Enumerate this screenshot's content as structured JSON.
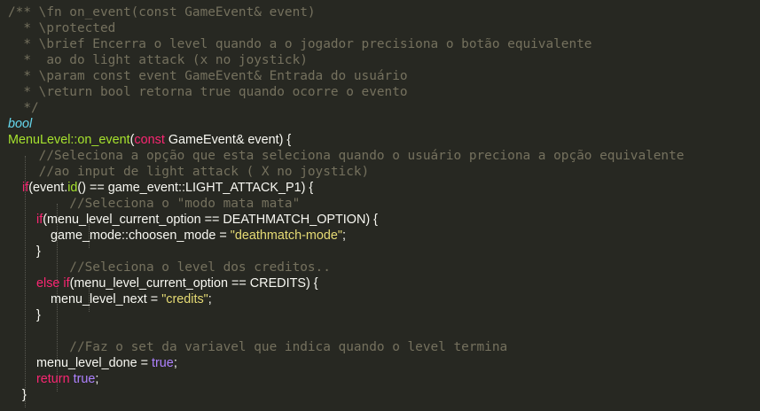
{
  "editor": {
    "theme_colors": {
      "background": "#272822",
      "comment": "#75715E",
      "plain": "#F8F8F2",
      "type": "#66D9EF",
      "function": "#A6E22E",
      "keyword": "#F92672",
      "string": "#E6DB74",
      "constant": "#AE81FF"
    },
    "lines": [
      {
        "tokens": [
          {
            "t": "/** \\fn on_event(const GameEvent& event)",
            "k": "comment",
            "f": "mono"
          }
        ]
      },
      {
        "tokens": [
          {
            "t": "  * \\protected",
            "k": "comment",
            "f": "mono"
          }
        ]
      },
      {
        "tokens": [
          {
            "t": "  * \\brief Encerra o level quando a o jogador precisiona o botão equivalente",
            "k": "comment",
            "f": "mono"
          }
        ]
      },
      {
        "tokens": [
          {
            "t": "  *  ao do light attack (x no joystick)",
            "k": "comment",
            "f": "mono"
          }
        ]
      },
      {
        "tokens": [
          {
            "t": "  * \\param const event GameEvent& Entrada do usuário",
            "k": "comment",
            "f": "mono"
          }
        ]
      },
      {
        "tokens": [
          {
            "t": "  * \\return bool retorna true quando ocorre o evento",
            "k": "comment",
            "f": "mono"
          }
        ]
      },
      {
        "tokens": [
          {
            "t": "  */",
            "k": "comment",
            "f": "mono"
          }
        ]
      },
      {
        "tokens": [
          {
            "t": "bool",
            "k": "type",
            "f": "sans"
          }
        ]
      },
      {
        "tokens": [
          {
            "t": "MenuLevel::on_event",
            "k": "function",
            "f": "sans"
          },
          {
            "t": "(",
            "k": "plain",
            "f": "sans"
          },
          {
            "t": "const",
            "k": "keyword",
            "f": "sans"
          },
          {
            "t": " GameEvent& event) {",
            "k": "plain",
            "f": "sans"
          }
        ]
      },
      {
        "tokens": [
          {
            "t": "    //Seleciona a opção que esta seleciona quando o usuário preciona a opção equivalente",
            "k": "comment",
            "f": "mono"
          }
        ]
      },
      {
        "tokens": [
          {
            "t": "    //ao input de light attack ( X no joystick)",
            "k": "comment",
            "f": "mono"
          }
        ]
      },
      {
        "tokens": [
          {
            "t": "    ",
            "k": "plain",
            "f": "sans"
          },
          {
            "t": "if",
            "k": "keyword",
            "f": "sans"
          },
          {
            "t": "(event.",
            "k": "plain",
            "f": "sans"
          },
          {
            "t": "id",
            "k": "function",
            "f": "sans"
          },
          {
            "t": "() == game_event::LIGHT_ATTACK_P1) {",
            "k": "plain",
            "f": "sans"
          }
        ]
      },
      {
        "tokens": [
          {
            "t": "        //Seleciona o \"modo mata mata\"",
            "k": "comment",
            "f": "mono"
          }
        ]
      },
      {
        "tokens": [
          {
            "t": "        ",
            "k": "plain",
            "f": "sans"
          },
          {
            "t": "if",
            "k": "keyword",
            "f": "sans"
          },
          {
            "t": "(menu_level_current_option == DEATHMATCH_OPTION) {",
            "k": "plain",
            "f": "sans"
          }
        ]
      },
      {
        "tokens": [
          {
            "t": "            game_mode::choosen_mode = ",
            "k": "plain",
            "f": "sans"
          },
          {
            "t": "\"deathmatch-mode\"",
            "k": "string",
            "f": "sans"
          },
          {
            "t": ";",
            "k": "plain",
            "f": "sans"
          }
        ]
      },
      {
        "tokens": [
          {
            "t": "        }",
            "k": "plain",
            "f": "sans"
          }
        ]
      },
      {
        "tokens": [
          {
            "t": "        //Seleciona o level dos creditos..",
            "k": "comment",
            "f": "mono"
          }
        ]
      },
      {
        "tokens": [
          {
            "t": "        ",
            "k": "plain",
            "f": "sans"
          },
          {
            "t": "else if",
            "k": "keyword",
            "f": "sans"
          },
          {
            "t": "(menu_level_current_option == CREDITS) {",
            "k": "plain",
            "f": "sans"
          }
        ]
      },
      {
        "tokens": [
          {
            "t": "            menu_level_next = ",
            "k": "plain",
            "f": "sans"
          },
          {
            "t": "\"credits\"",
            "k": "string",
            "f": "sans"
          },
          {
            "t": ";",
            "k": "plain",
            "f": "sans"
          }
        ]
      },
      {
        "tokens": [
          {
            "t": "        }",
            "k": "plain",
            "f": "sans"
          }
        ]
      },
      {
        "tokens": [
          {
            "t": "",
            "k": "plain",
            "f": "sans"
          }
        ]
      },
      {
        "tokens": [
          {
            "t": "        //Faz o set da variavel que indica quando o level termina",
            "k": "comment",
            "f": "mono"
          }
        ]
      },
      {
        "tokens": [
          {
            "t": "        menu_level_done = ",
            "k": "plain",
            "f": "sans"
          },
          {
            "t": "true",
            "k": "constant",
            "f": "sans"
          },
          {
            "t": ";",
            "k": "plain",
            "f": "sans"
          }
        ]
      },
      {
        "tokens": [
          {
            "t": "        ",
            "k": "plain",
            "f": "sans"
          },
          {
            "t": "return",
            "k": "keyword",
            "f": "sans"
          },
          {
            "t": " ",
            "k": "plain",
            "f": "sans"
          },
          {
            "t": "true",
            "k": "constant",
            "f": "sans"
          },
          {
            "t": ";",
            "k": "plain",
            "f": "sans"
          }
        ]
      },
      {
        "tokens": [
          {
            "t": "    }",
            "k": "plain",
            "f": "sans"
          }
        ]
      }
    ]
  }
}
